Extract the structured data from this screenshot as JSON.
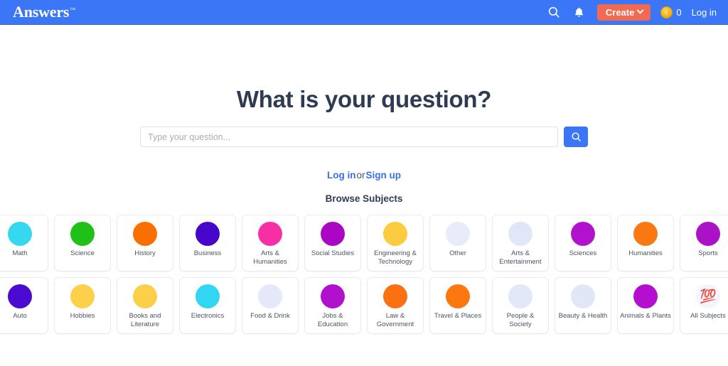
{
  "header": {
    "logo_text": "Answers",
    "logo_tm": "™",
    "search_icon": "search-icon",
    "bell_icon": "notification-bell-icon",
    "create_label": "Create",
    "coin_icon": "coin-icon",
    "coin_glyph": "Ⓐ",
    "coin_count": "0",
    "login_label": "Log in",
    "accent_blue": "#3b76f6",
    "create_color": "#f26a52"
  },
  "hero": {
    "title": "What is your question?",
    "search_placeholder": "Type your question...",
    "search_value": "",
    "submit_icon": "search-icon"
  },
  "auth": {
    "login_label": "Log in",
    "or_label": "or",
    "signup_label": "Sign up"
  },
  "browse": {
    "title": "Browse Subjects",
    "tiles": [
      {
        "label": "Math",
        "color": "#35d8ef",
        "icon": "circle-icon"
      },
      {
        "label": "Science",
        "color": "#1fc119",
        "icon": "circle-icon"
      },
      {
        "label": "History",
        "color": "#fa7000",
        "icon": "circle-icon"
      },
      {
        "label": "Business",
        "color": "#4607cb",
        "icon": "circle-icon"
      },
      {
        "label": "Arts & Humanities",
        "color": "#f62fa4",
        "icon": "circle-icon"
      },
      {
        "label": "Social Studies",
        "color": "#a907c4",
        "icon": "circle-icon"
      },
      {
        "label": "Engineering & Technology",
        "color": "#fccb3f",
        "icon": "circle-icon"
      },
      {
        "label": "Other",
        "color": "#e7ebfa",
        "icon": "circle-icon"
      },
      {
        "label": "Arts & Entertainment",
        "color": "#e1e7f8",
        "icon": "circle-icon"
      },
      {
        "label": "Sciences",
        "color": "#b113cd",
        "icon": "circle-icon"
      },
      {
        "label": "Humanities",
        "color": "#fa7812",
        "icon": "circle-icon"
      },
      {
        "label": "Sports",
        "color": "#ab12c5",
        "icon": "circle-icon"
      },
      {
        "label": "Auto",
        "color": "#4a0ad0",
        "icon": "circle-icon"
      },
      {
        "label": "Hobbies",
        "color": "#fbd04b",
        "icon": "circle-icon"
      },
      {
        "label": "Books and Literature",
        "color": "#fbcf49",
        "icon": "circle-icon"
      },
      {
        "label": "Electronics",
        "color": "#31d6f2",
        "icon": "circle-icon"
      },
      {
        "label": "Food & Drink",
        "color": "#e3e9f9",
        "icon": "circle-icon"
      },
      {
        "label": "Jobs & Education",
        "color": "#b011cb",
        "icon": "circle-icon"
      },
      {
        "label": "Law & Government",
        "color": "#fb7111",
        "icon": "circle-icon"
      },
      {
        "label": "Travel & Places",
        "color": "#fb7710",
        "icon": "circle-icon"
      },
      {
        "label": "People & Society",
        "color": "#e2e8f8",
        "icon": "circle-icon"
      },
      {
        "label": "Beauty & Health",
        "color": "#e2e7f7",
        "icon": "circle-icon"
      },
      {
        "label": "Animals & Plants",
        "color": "#b40ecf",
        "icon": "circle-icon"
      },
      {
        "label": "All Subjects",
        "color": "#f4f6fd",
        "icon": "hundred-points-icon",
        "emoji": "💯"
      }
    ]
  }
}
